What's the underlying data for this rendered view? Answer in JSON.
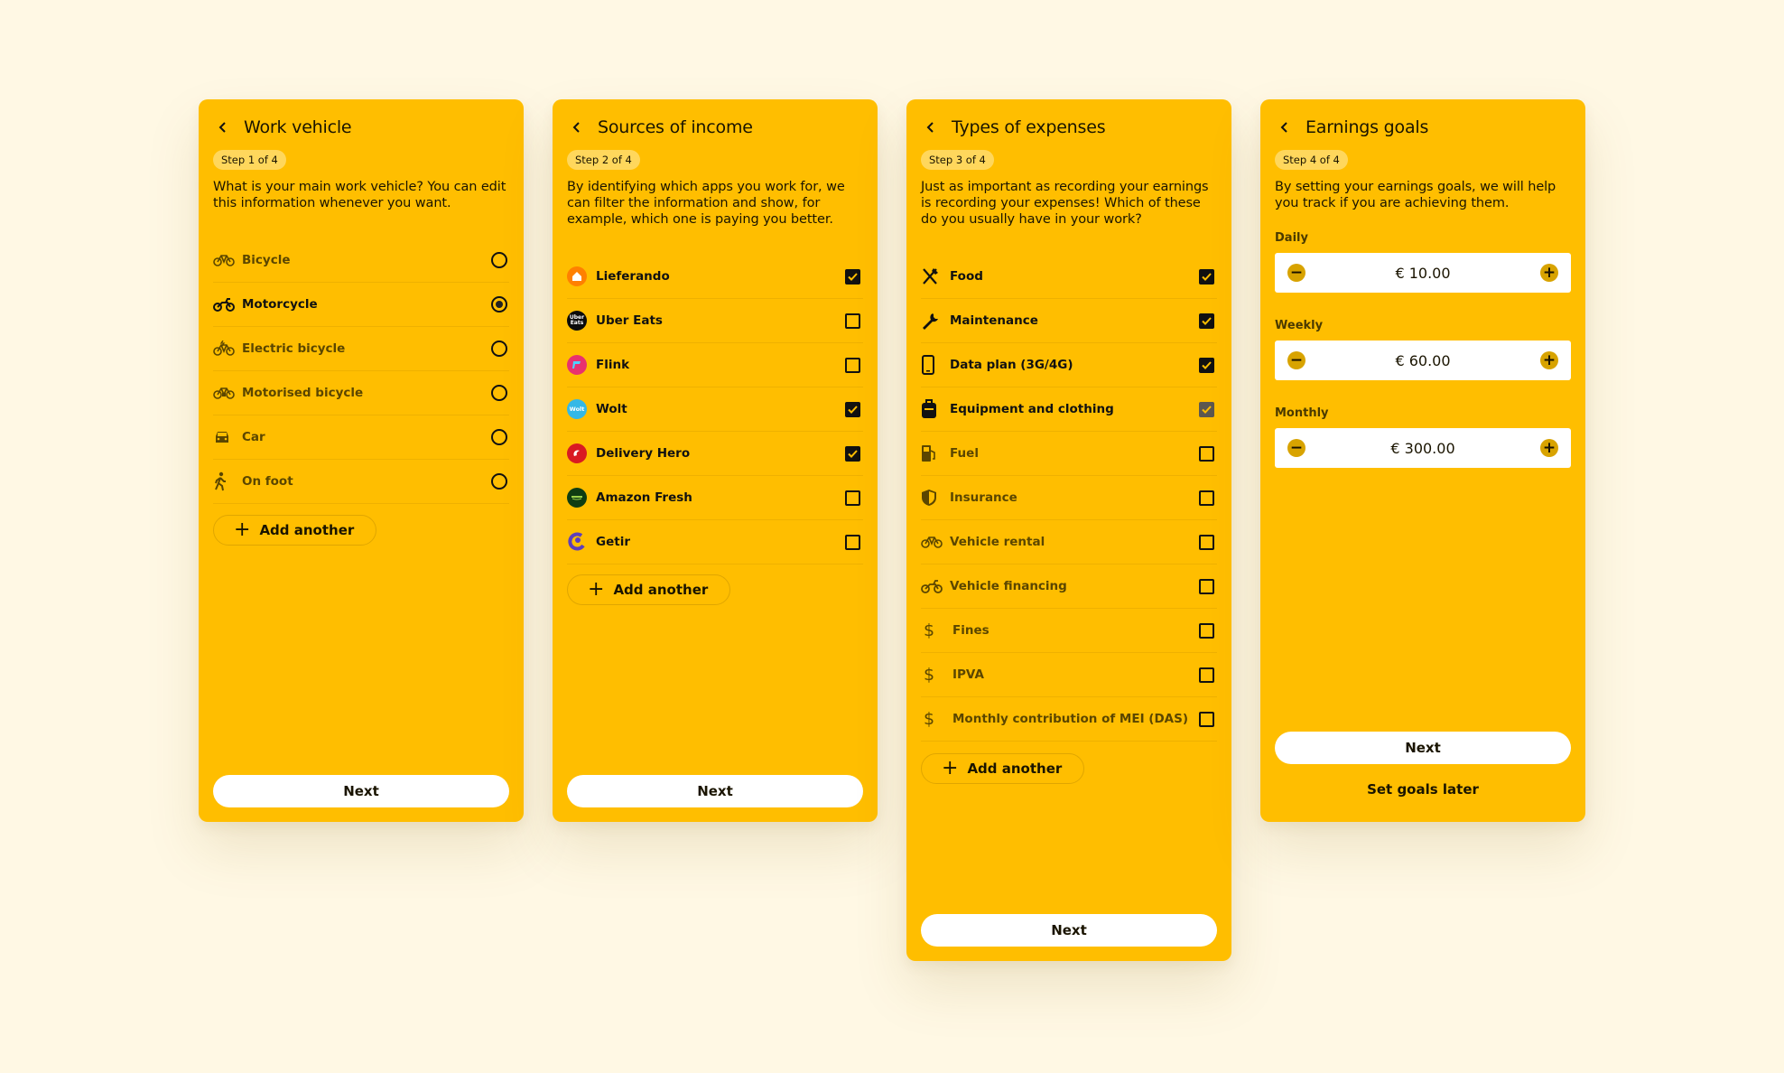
{
  "cards": [
    {
      "title": "Work vehicle",
      "step": "Step 1 of 4",
      "description": "What is your main work vehicle? You can edit this information whenever you want.",
      "items": [
        {
          "label": "Bicycle",
          "icon": "bicycle-icon",
          "selected": false
        },
        {
          "label": "Motorcycle",
          "icon": "motorcycle-icon",
          "selected": true
        },
        {
          "label": "Electric bicycle",
          "icon": "electric-bicycle-icon",
          "selected": false
        },
        {
          "label": "Motorised bicycle",
          "icon": "motorised-bicycle-icon",
          "selected": false
        },
        {
          "label": "Car",
          "icon": "car-icon",
          "selected": false
        },
        {
          "label": "On foot",
          "icon": "walking-icon",
          "selected": false
        }
      ],
      "add_label": "Add another",
      "next_label": "Next"
    },
    {
      "title": "Sources of income",
      "step": "Step 2 of 4",
      "description": "By identifying which apps you work for, we can filter the information and show, for example, which one is paying you better.",
      "items": [
        {
          "label": "Lieferando",
          "icon": "lieferando-logo",
          "color": "#ff8000",
          "checked": true
        },
        {
          "label": "Uber Eats",
          "icon": "uber-eats-logo",
          "logo_text": "Uber Eats",
          "color": "#0b0b0b",
          "checked": false
        },
        {
          "label": "Flink",
          "icon": "flink-logo",
          "color": "#e8316f",
          "checked": false
        },
        {
          "label": "Wolt",
          "icon": "wolt-logo",
          "logo_text": "Wolt",
          "color": "#34b8e6",
          "checked": true
        },
        {
          "label": "Delivery Hero",
          "icon": "delivery-hero-logo",
          "color": "#d91a22",
          "checked": true
        },
        {
          "label": "Amazon Fresh",
          "icon": "amazon-fresh-logo",
          "color": "#0f3d12",
          "checked": false
        },
        {
          "label": "Getir",
          "icon": "getir-logo",
          "color": "#5d3ebc",
          "checked": false
        }
      ],
      "add_label": "Add another",
      "next_label": "Next"
    },
    {
      "title": "Types of expenses",
      "step": "Step 3 of 4",
      "description": "Just as important as recording your earnings is recording your expenses! Which of these do you usually have in your work?",
      "items": [
        {
          "label": "Food",
          "icon": "fork-knife-icon",
          "checked": true
        },
        {
          "label": "Maintenance",
          "icon": "wrench-icon",
          "checked": true
        },
        {
          "label": "Data plan (3G/4G)",
          "icon": "smartphone-icon",
          "checked": true
        },
        {
          "label": "Equipment and clothing",
          "icon": "backpack-icon",
          "checked": true,
          "grey": true
        },
        {
          "label": "Fuel",
          "icon": "fuel-pump-icon",
          "checked": false
        },
        {
          "label": "Insurance",
          "icon": "shield-icon",
          "checked": false
        },
        {
          "label": "Vehicle rental",
          "icon": "bicycle-icon",
          "checked": false
        },
        {
          "label": "Vehicle financing",
          "icon": "motorcycle-icon",
          "checked": false
        },
        {
          "label": "Fines",
          "icon": "dollar-icon",
          "checked": false
        },
        {
          "label": "IPVA",
          "icon": "dollar-icon",
          "checked": false
        },
        {
          "label": "Monthly contribution of MEI (DAS)",
          "icon": "dollar-icon",
          "checked": false
        }
      ],
      "add_label": "Add another",
      "next_label": "Next"
    },
    {
      "title": "Earnings goals",
      "step": "Step 4 of 4",
      "description": "By setting your earnings goals, we will help you track if you are achieving them.",
      "goals": [
        {
          "label": "Daily",
          "value": "€ 10.00"
        },
        {
          "label": "Weekly",
          "value": "€ 60.00"
        },
        {
          "label": "Monthly",
          "value": "€ 300.00"
        }
      ],
      "next_label": "Next",
      "later_label": "Set goals later"
    }
  ],
  "colors": {
    "page_background": "#fff8e4",
    "card": "#ffbe00",
    "step_badge": "#ffd75c",
    "button": "#ffffff",
    "goal_control": "#d8a300"
  }
}
